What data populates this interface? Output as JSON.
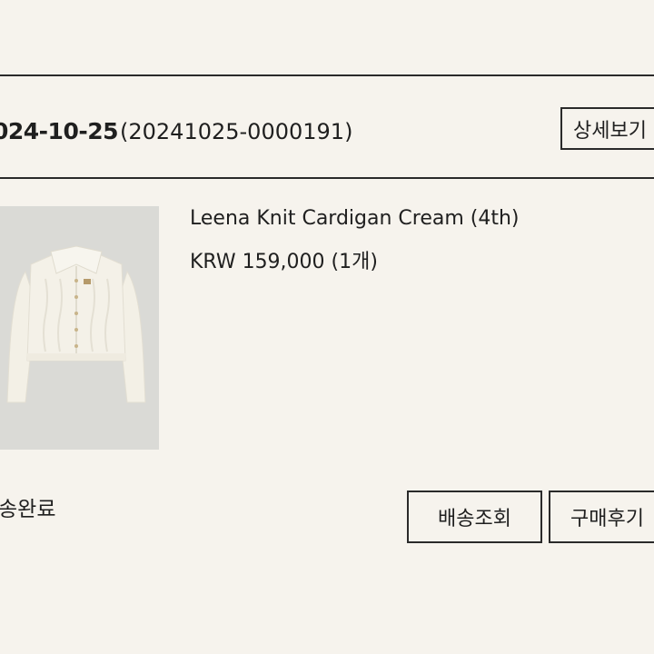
{
  "order": {
    "date": "024-10-25",
    "number": "(20241025-0000191)",
    "detail_button": "상세보기"
  },
  "product": {
    "image_alt": "cream cable knit cardigan",
    "name": "Leena Knit Cardigan Cream (4th)",
    "price": "KRW 159,000 (1개)"
  },
  "status": {
    "label": "송완료"
  },
  "actions": {
    "track_button": "배송조회",
    "review_button": "구매후기"
  },
  "colors": {
    "background": "#f6f3ed",
    "border": "#2a2a2a",
    "thumb_bg": "#dadad6",
    "cardigan": "#f3f0e6"
  }
}
